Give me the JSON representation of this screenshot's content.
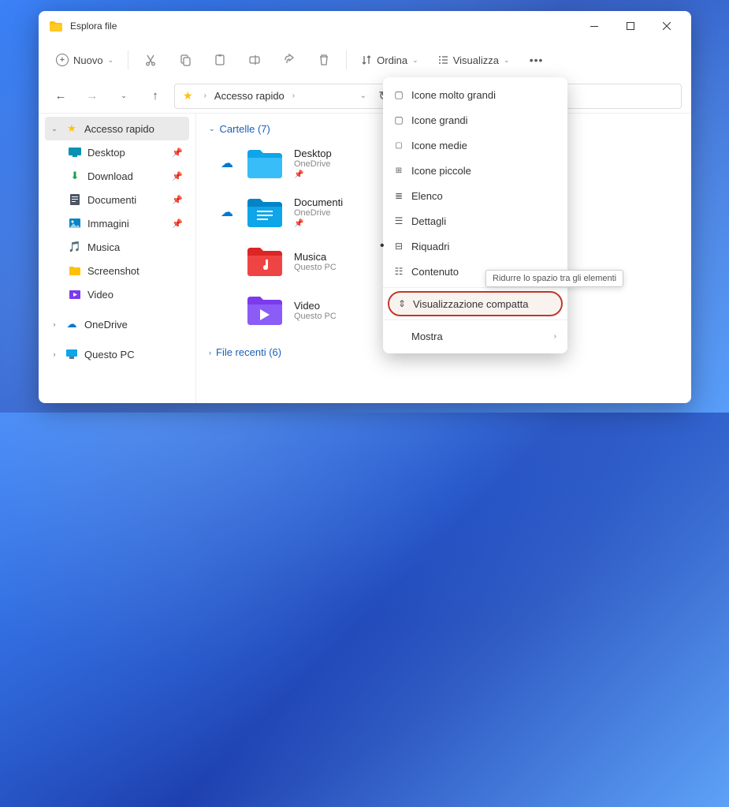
{
  "titlebar": {
    "title": "Esplora file"
  },
  "toolbar": {
    "new_label": "Nuovo",
    "sort_label": "Ordina",
    "view_label": "Visualizza"
  },
  "breadcrumb": {
    "root": "Accesso rapido"
  },
  "sidebar": {
    "quick": "Accesso rapido",
    "items": [
      {
        "label": "Desktop"
      },
      {
        "label": "Download"
      },
      {
        "label": "Documenti"
      },
      {
        "label": "Immagini"
      },
      {
        "label": "Musica"
      },
      {
        "label": "Screenshot"
      },
      {
        "label": "Video"
      }
    ],
    "onedrive": "OneDrive",
    "thispc": "Questo PC"
  },
  "content": {
    "folders_header": "Cartelle (7)",
    "recent_header": "File recenti (6)",
    "folders": [
      {
        "name": "Desktop",
        "sub": "OneDrive",
        "sync": true
      },
      {
        "name": "Documenti",
        "sub": "OneDrive",
        "sync": true
      },
      {
        "name": "Musica",
        "sub": "Questo PC",
        "sync": false
      },
      {
        "name": "Video",
        "sub": "Questo PC",
        "sync": false
      }
    ]
  },
  "menu": {
    "i0": "Icone molto grandi",
    "i1": "Icone grandi",
    "i2": "Icone medie",
    "i3": "Icone piccole",
    "i4": "Elenco",
    "i5": "Dettagli",
    "i6": "Riquadri",
    "i7": "Contenuto",
    "i8": "Visualizzazione compatta",
    "i9": "Mostra"
  },
  "tooltip": "Ridurre lo spazio tra gli elementi"
}
